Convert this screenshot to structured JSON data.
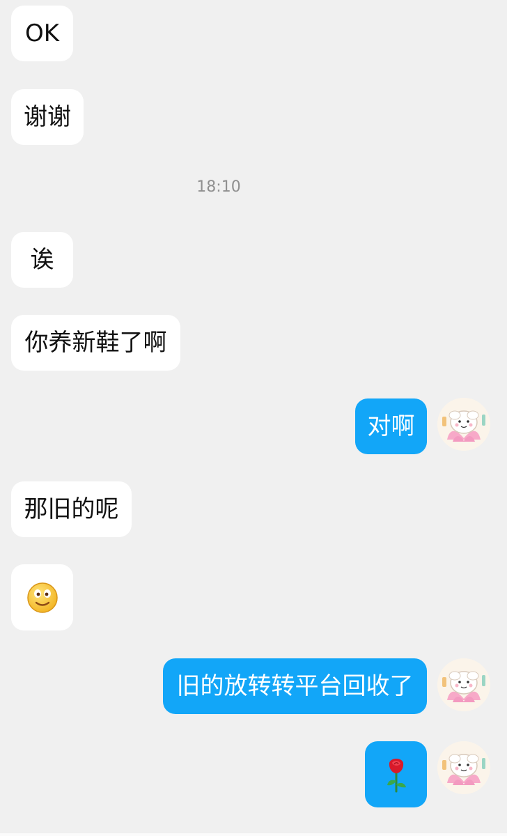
{
  "chat": {
    "timestamp": "18:10",
    "messages": [
      {
        "side": "incoming",
        "text": "OK"
      },
      {
        "side": "incoming",
        "text": "谢谢"
      },
      {
        "side": "incoming",
        "text": "诶"
      },
      {
        "side": "incoming",
        "text": "你养新鞋了啊"
      },
      {
        "side": "outgoing",
        "text": "对啊"
      },
      {
        "side": "incoming",
        "text": "那旧的呢"
      },
      {
        "side": "incoming",
        "emoji": "smile-emoji"
      },
      {
        "side": "outgoing",
        "text": "旧的放转转平台回收了"
      },
      {
        "side": "outgoing",
        "emoji": "rose-emoji"
      }
    ]
  },
  "avatar": {
    "icon": "sheep-lotus-avatar-icon"
  },
  "colors": {
    "background": "#f0f0f0",
    "incoming_bubble": "#ffffff",
    "outgoing_bubble": "#12a6f8",
    "timestamp": "#8f8f8f"
  }
}
